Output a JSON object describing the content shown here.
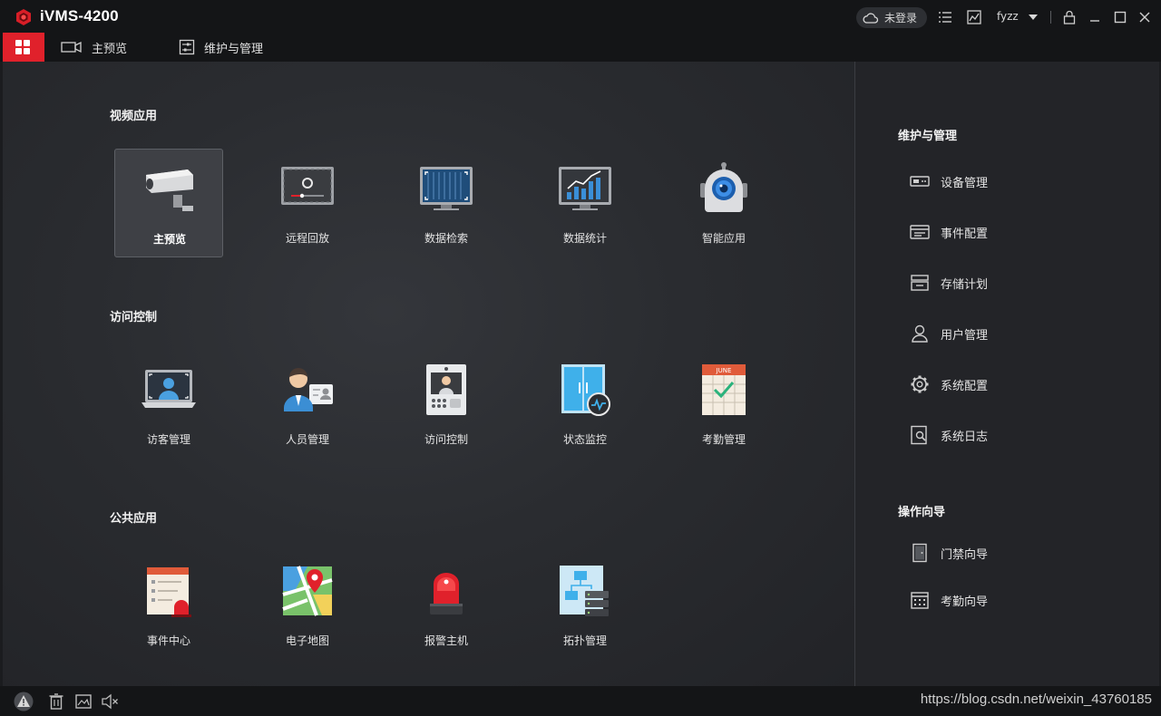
{
  "app": {
    "title": "iVMS-4200"
  },
  "titlebar": {
    "login_label": "未登录",
    "user_name": "fyzz"
  },
  "nav": {
    "tabs": [
      {
        "label": "主预览"
      },
      {
        "label": "维护与管理"
      }
    ]
  },
  "sections": [
    {
      "title": "视频应用",
      "items": [
        {
          "label": "主预览",
          "icon": "camera-icon",
          "selected": true
        },
        {
          "label": "远程回放",
          "icon": "playback-monitor-icon"
        },
        {
          "label": "数据检索",
          "icon": "search-monitor-icon"
        },
        {
          "label": "数据统计",
          "icon": "stats-monitor-icon"
        },
        {
          "label": "智能应用",
          "icon": "smart-camera-icon"
        }
      ]
    },
    {
      "title": "访问控制",
      "items": [
        {
          "label": "访客管理",
          "icon": "visitor-laptop-icon"
        },
        {
          "label": "人员管理",
          "icon": "person-card-icon"
        },
        {
          "label": "访问控制",
          "icon": "intercom-icon"
        },
        {
          "label": "状态监控",
          "icon": "door-monitor-icon"
        },
        {
          "label": "考勤管理",
          "icon": "calendar-icon",
          "month": "JUNE"
        }
      ]
    },
    {
      "title": "公共应用",
      "items": [
        {
          "label": "事件中心",
          "icon": "event-list-icon"
        },
        {
          "label": "电子地图",
          "icon": "map-pin-icon"
        },
        {
          "label": "报警主机",
          "icon": "alarm-siren-icon"
        },
        {
          "label": "拓扑管理",
          "icon": "topology-icon"
        }
      ]
    }
  ],
  "maintenance": {
    "title": "维护与管理",
    "items": [
      {
        "label": "设备管理",
        "icon": "device-icon"
      },
      {
        "label": "事件配置",
        "icon": "event-config-icon"
      },
      {
        "label": "存储计划",
        "icon": "storage-icon"
      },
      {
        "label": "用户管理",
        "icon": "user-icon"
      },
      {
        "label": "系统配置",
        "icon": "gear-icon"
      },
      {
        "label": "系统日志",
        "icon": "log-icon"
      }
    ]
  },
  "guide": {
    "title": "操作向导",
    "items": [
      {
        "label": "门禁向导",
        "icon": "door-icon"
      },
      {
        "label": "考勤向导",
        "icon": "attendance-icon"
      }
    ]
  },
  "statusbar": {
    "watermark": "https://blog.csdn.net/weixin_43760185"
  },
  "colors": {
    "accent": "#e0212b",
    "background": "#2a2c30"
  }
}
